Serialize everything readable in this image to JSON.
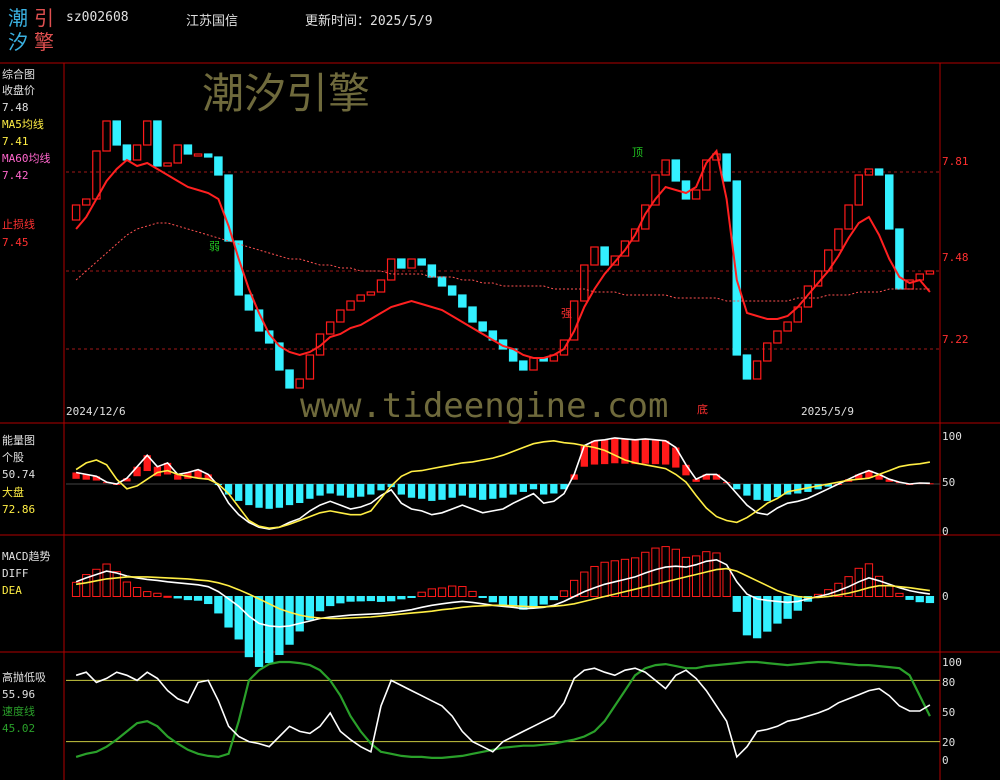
{
  "header": {
    "logo_chars": [
      "潮",
      "引",
      "汐",
      "擎"
    ],
    "stock_code": "sz002608",
    "stock_name": "江苏国信",
    "update_label": "更新时间：",
    "update_date": "2025/5/9"
  },
  "watermarks": {
    "cn": "潮汐引擎",
    "url": "www.tideengine.com"
  },
  "colors": {
    "up": "#ff1a1a",
    "down": "#33f0ff",
    "ma5": "#ff2020",
    "ma60": "#ff5050",
    "white": "#ffffff",
    "yellow": "#ffee44",
    "green": "#2aa02a",
    "grid": "#b00000"
  },
  "panels": {
    "main": {
      "title": "综合图",
      "close_label": "收盘价",
      "close_value": "7.48",
      "ma5_label": "MA5均线",
      "ma5_value": "7.41",
      "ma60_label": "MA60均线",
      "ma60_value": "7.42",
      "stop_label": "止损线",
      "stop_value": "7.45",
      "y_ticks": [
        "7.81",
        "7.48",
        "7.22"
      ],
      "date_start": "2024/12/6",
      "date_end": "2025/5/9",
      "annotations": [
        "顶",
        "弱",
        "强",
        "底"
      ]
    },
    "energy": {
      "title": "能量图",
      "stock_label": "个股",
      "stock_value": "50.74",
      "market_label": "大盘",
      "market_value": "72.86",
      "y_ticks": [
        "100",
        "50",
        "0"
      ]
    },
    "macd": {
      "title": "MACD趋势",
      "diff_label": "DIFF",
      "dea_label": "DEA",
      "y_ticks": [
        "0"
      ]
    },
    "hilo": {
      "title": "高抛低吸",
      "main_value": "55.96",
      "speed_label": "速度线",
      "speed_value": "45.02",
      "y_ticks": [
        "100",
        "80",
        "50",
        "20",
        "0"
      ]
    }
  },
  "chart_data": [
    {
      "type": "candlestick",
      "title": "综合图",
      "y_ticks": [
        7.81,
        7.48,
        7.22
      ],
      "ylim": [
        7.05,
        8.15
      ],
      "x_start": "2024/12/6",
      "x_end": "2025/5/9",
      "close": [
        7.7,
        7.72,
        7.88,
        7.98,
        7.9,
        7.85,
        7.9,
        7.98,
        7.83,
        7.84,
        7.9,
        7.87,
        7.87,
        7.86,
        7.8,
        7.58,
        7.4,
        7.35,
        7.28,
        7.24,
        7.15,
        7.09,
        7.12,
        7.2,
        7.27,
        7.31,
        7.35,
        7.38,
        7.4,
        7.41,
        7.45,
        7.52,
        7.49,
        7.52,
        7.5,
        7.46,
        7.43,
        7.4,
        7.36,
        7.31,
        7.28,
        7.25,
        7.22,
        7.18,
        7.15,
        7.19,
        7.18,
        7.2,
        7.25,
        7.38,
        7.5,
        7.56,
        7.5,
        7.53,
        7.58,
        7.62,
        7.7,
        7.8,
        7.85,
        7.78,
        7.72,
        7.75,
        7.85,
        7.87,
        7.78,
        7.2,
        7.12,
        7.18,
        7.24,
        7.28,
        7.31,
        7.36,
        7.43,
        7.48,
        7.55,
        7.62,
        7.7,
        7.8,
        7.82,
        7.8,
        7.62,
        7.42,
        7.45,
        7.47,
        7.48
      ],
      "ma5": [
        7.62,
        7.66,
        7.72,
        7.78,
        7.82,
        7.85,
        7.83,
        7.84,
        7.82,
        7.8,
        7.78,
        7.76,
        7.75,
        7.74,
        7.72,
        7.63,
        7.52,
        7.42,
        7.34,
        7.27,
        7.23,
        7.21,
        7.2,
        7.21,
        7.23,
        7.26,
        7.27,
        7.29,
        7.3,
        7.32,
        7.34,
        7.36,
        7.37,
        7.38,
        7.37,
        7.36,
        7.35,
        7.33,
        7.31,
        7.29,
        7.27,
        7.25,
        7.23,
        7.22,
        7.2,
        7.19,
        7.19,
        7.2,
        7.22,
        7.28,
        7.36,
        7.42,
        7.47,
        7.51,
        7.55,
        7.6,
        7.67,
        7.72,
        7.76,
        7.75,
        7.74,
        7.76,
        7.84,
        7.88,
        7.72,
        7.45,
        7.34,
        7.33,
        7.32,
        7.32,
        7.33,
        7.36,
        7.4,
        7.44,
        7.48,
        7.53,
        7.59,
        7.64,
        7.66,
        7.6,
        7.52,
        7.46,
        7.44,
        7.45,
        7.41
      ],
      "ma60": [
        7.45,
        7.48,
        7.51,
        7.54,
        7.57,
        7.6,
        7.62,
        7.63,
        7.64,
        7.64,
        7.63,
        7.62,
        7.61,
        7.6,
        7.59,
        7.58,
        7.57,
        7.56,
        7.55,
        7.54,
        7.53,
        7.52,
        7.52,
        7.51,
        7.5,
        7.5,
        7.49,
        7.49,
        7.48,
        7.48,
        7.48,
        7.47,
        7.47,
        7.47,
        7.47,
        7.46,
        7.46,
        7.46,
        7.45,
        7.45,
        7.44,
        7.44,
        7.43,
        7.43,
        7.43,
        7.43,
        7.43,
        7.42,
        7.42,
        7.42,
        7.42,
        7.41,
        7.41,
        7.41,
        7.4,
        7.4,
        7.4,
        7.4,
        7.4,
        7.39,
        7.39,
        7.39,
        7.39,
        7.39,
        7.38,
        7.38,
        7.38,
        7.38,
        7.38,
        7.38,
        7.38,
        7.39,
        7.39,
        7.39,
        7.4,
        7.4,
        7.4,
        7.41,
        7.41,
        7.41,
        7.42,
        7.42,
        7.42,
        7.42,
        7.42
      ]
    },
    {
      "type": "bar",
      "title": "能量图",
      "ylim": [
        0,
        100
      ],
      "series": [
        {
          "name": "个股",
          "values": [
            62,
            60,
            58,
            52,
            50,
            56,
            68,
            80,
            68,
            72,
            60,
            62,
            65,
            60,
            48,
            30,
            18,
            10,
            5,
            3,
            5,
            10,
            14,
            22,
            28,
            32,
            28,
            24,
            26,
            30,
            38,
            44,
            30,
            24,
            22,
            18,
            20,
            24,
            28,
            24,
            20,
            22,
            24,
            30,
            35,
            40,
            30,
            32,
            40,
            60,
            90,
            95,
            96,
            98,
            97,
            96,
            97,
            96,
            95,
            88,
            70,
            55,
            60,
            60,
            52,
            40,
            28,
            20,
            18,
            25,
            30,
            32,
            35,
            40,
            45,
            50,
            55,
            60,
            64,
            60,
            55,
            52,
            50,
            51,
            50.74
          ]
        },
        {
          "name": "大盘",
          "values": [
            65,
            72,
            75,
            70,
            55,
            45,
            48,
            55,
            62,
            64,
            60,
            58,
            56,
            55,
            50,
            40,
            26,
            12,
            6,
            4,
            5,
            8,
            12,
            16,
            20,
            22,
            20,
            18,
            18,
            22,
            35,
            48,
            58,
            63,
            64,
            66,
            68,
            70,
            72,
            73,
            75,
            77,
            80,
            84,
            88,
            92,
            94,
            95,
            93,
            92,
            90,
            88,
            85,
            80,
            75,
            72,
            70,
            68,
            66,
            60,
            52,
            38,
            25,
            16,
            12,
            10,
            15,
            22,
            30,
            35,
            42,
            44,
            46,
            48,
            50,
            52,
            54,
            55,
            56,
            60,
            64,
            68,
            70,
            71,
            72.86
          ]
        }
      ]
    },
    {
      "type": "bar",
      "title": "MACD趋势",
      "ylim": [
        -1,
        1
      ],
      "series": [
        {
          "name": "DIFF",
          "values": [
            0.3,
            0.38,
            0.45,
            0.52,
            0.48,
            0.42,
            0.38,
            0.35,
            0.33,
            0.3,
            0.28,
            0.26,
            0.24,
            0.2,
            0.1,
            -0.05,
            -0.2,
            -0.4,
            -0.55,
            -0.6,
            -0.62,
            -0.6,
            -0.55,
            -0.5,
            -0.45,
            -0.42,
            -0.4,
            -0.38,
            -0.37,
            -0.36,
            -0.35,
            -0.33,
            -0.3,
            -0.27,
            -0.22,
            -0.18,
            -0.15,
            -0.12,
            -0.1,
            -0.12,
            -0.15,
            -0.18,
            -0.2,
            -0.22,
            -0.25,
            -0.24,
            -0.22,
            -0.18,
            -0.1,
            0.0,
            0.1,
            0.18,
            0.25,
            0.3,
            0.35,
            0.4,
            0.48,
            0.55,
            0.6,
            0.62,
            0.6,
            0.65,
            0.72,
            0.75,
            0.65,
            0.3,
            0.05,
            -0.05,
            -0.08,
            -0.1,
            -0.12,
            -0.1,
            -0.05,
            0.0,
            0.05,
            0.12,
            0.2,
            0.3,
            0.38,
            0.32,
            0.25,
            0.18,
            0.12,
            0.08,
            0.05
          ]
        },
        {
          "name": "DEA",
          "values": [
            0.25,
            0.28,
            0.32,
            0.36,
            0.38,
            0.4,
            0.4,
            0.4,
            0.39,
            0.38,
            0.37,
            0.36,
            0.34,
            0.32,
            0.28,
            0.22,
            0.14,
            0.05,
            -0.05,
            -0.15,
            -0.25,
            -0.32,
            -0.38,
            -0.42,
            -0.44,
            -0.45,
            -0.45,
            -0.44,
            -0.43,
            -0.42,
            -0.4,
            -0.38,
            -0.36,
            -0.34,
            -0.32,
            -0.3,
            -0.27,
            -0.25,
            -0.22,
            -0.2,
            -0.19,
            -0.18,
            -0.18,
            -0.19,
            -0.2,
            -0.21,
            -0.21,
            -0.2,
            -0.18,
            -0.15,
            -0.1,
            -0.05,
            0.0,
            0.05,
            0.1,
            0.15,
            0.2,
            0.25,
            0.3,
            0.35,
            0.4,
            0.45,
            0.5,
            0.55,
            0.57,
            0.52,
            0.42,
            0.32,
            0.22,
            0.12,
            0.05,
            0.0,
            -0.02,
            -0.02,
            0.0,
            0.03,
            0.07,
            0.12,
            0.18,
            0.22,
            0.22,
            0.2,
            0.18,
            0.15,
            0.12
          ]
        }
      ]
    },
    {
      "type": "line",
      "title": "高抛低吸",
      "ylim": [
        0,
        100
      ],
      "series": [
        {
          "name": "高抛低吸",
          "values": [
            85,
            88,
            78,
            82,
            88,
            85,
            80,
            88,
            82,
            70,
            62,
            58,
            78,
            80,
            60,
            35,
            25,
            20,
            18,
            15,
            25,
            35,
            30,
            28,
            35,
            48,
            30,
            22,
            15,
            10,
            55,
            80,
            75,
            70,
            65,
            60,
            55,
            45,
            30,
            20,
            15,
            10,
            20,
            25,
            30,
            35,
            40,
            45,
            58,
            82,
            90,
            92,
            88,
            85,
            90,
            92,
            88,
            80,
            72,
            85,
            90,
            82,
            70,
            55,
            40,
            5,
            15,
            30,
            32,
            35,
            40,
            42,
            45,
            48,
            52,
            58,
            62,
            66,
            70,
            72,
            65,
            55,
            50,
            50,
            55.96
          ]
        },
        {
          "name": "速度线",
          "values": [
            5,
            8,
            10,
            15,
            22,
            30,
            38,
            40,
            35,
            25,
            18,
            12,
            8,
            6,
            5,
            8,
            40,
            80,
            90,
            96,
            98,
            98,
            97,
            95,
            90,
            80,
            65,
            45,
            30,
            18,
            10,
            8,
            6,
            5,
            5,
            4,
            4,
            5,
            6,
            8,
            10,
            12,
            14,
            15,
            16,
            16,
            17,
            18,
            20,
            22,
            25,
            30,
            40,
            55,
            70,
            85,
            92,
            95,
            96,
            94,
            92,
            92,
            94,
            95,
            96,
            97,
            98,
            98,
            97,
            96,
            95,
            96,
            97,
            98,
            98,
            97,
            96,
            95,
            95,
            94,
            93,
            92,
            85,
            65,
            45.02
          ]
        }
      ]
    }
  ]
}
